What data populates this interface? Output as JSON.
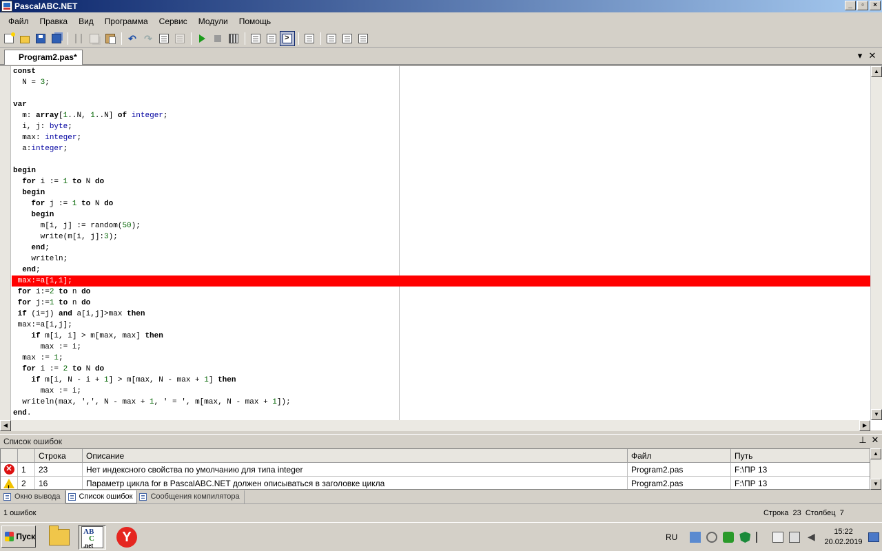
{
  "window": {
    "title": "PascalABC.NET"
  },
  "menu": [
    "Файл",
    "Правка",
    "Вид",
    "Программа",
    "Сервис",
    "Модули",
    "Помощь"
  ],
  "toolbar": {
    "buttons": [
      "new-file",
      "open",
      "save",
      "save-all",
      "cut",
      "copy",
      "paste",
      "undo",
      "redo",
      "find",
      "replace",
      "run",
      "stop",
      "compile",
      "debug-step-into",
      "debug-step-over",
      "output-window",
      "document",
      "form-1",
      "form-2",
      "form-3"
    ]
  },
  "editor": {
    "tab_label": "Program2.pas*",
    "lines": [
      "const",
      "  N = 3;",
      "",
      "var",
      "  m: array[1..N, 1..N] of integer;",
      "  i, j: byte;",
      "  max: integer;",
      "  a:integer;",
      "",
      "begin",
      "  for i := 1 to N do",
      "  begin",
      "    for j := 1 to N do",
      "    begin",
      "      m[i, j] := random(50);",
      "      write(m[i, j]:3);",
      "    end;",
      "    writeln;",
      "  end;",
      " max:=a[1,1];",
      " for i:=2 to n do",
      " for j:=1 to n do",
      " if (i=j) and a[i,j]>max then",
      " max:=a[i,j];",
      "    if m[i, i] > m[max, max] then",
      "      max := i;",
      "  max := 1;",
      "  for i := 2 to N do",
      "    if m[i, N - i + 1] > m[max, N - max + 1] then",
      "      max := i;",
      "  writeln(max, ',', N - max + 1, ' = ', m[max, N - max + 1]);",
      "end."
    ],
    "error_line_index": 19
  },
  "errors_panel": {
    "title": "Список ошибок",
    "columns": [
      "",
      "",
      "Строка",
      "Описание",
      "Файл",
      "Путь"
    ],
    "rows": [
      {
        "type": "error",
        "num": "1",
        "line": "23",
        "description": "Нет индексного свойства по умолчанию для типа integer",
        "file": "Program2.pas",
        "path": "F:\\ПР 13"
      },
      {
        "type": "warning",
        "num": "2",
        "line": "16",
        "description": "Параметр цикла for в PascalABC.NET должен описываться в заголовке цикла",
        "file": "Program2.pas",
        "path": "F:\\ПР 13"
      }
    ]
  },
  "bottom_tabs": [
    "Окно вывода",
    "Список ошибок",
    "Сообщения компилятора"
  ],
  "status": {
    "errors": "1 ошибок",
    "position": "Строка  23  Столбец  7"
  },
  "taskbar": {
    "start": "Пуск",
    "lang": "RU",
    "time": "15:22",
    "date": "20.02.2019",
    "abc_icon_text": [
      "AB",
      "C",
      ".net"
    ],
    "yandex_letter": "Y"
  },
  "colors": {
    "error_line": "#ff0000",
    "title_start": "#0a246a",
    "title_end": "#a6caf0"
  }
}
